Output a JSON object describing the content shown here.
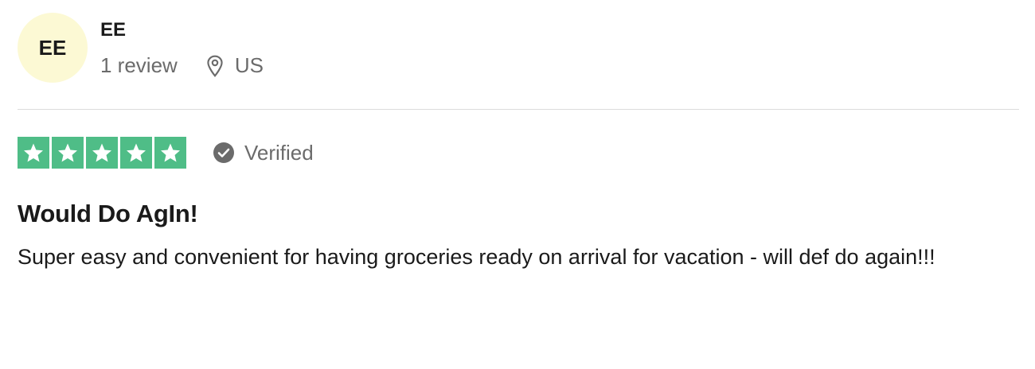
{
  "reviewer": {
    "initials": "EE",
    "name": "EE",
    "review_count": "1 review",
    "country": "US",
    "avatar_color": "#fcf9d4",
    "location_icon": "map-pin-icon"
  },
  "rating": {
    "stars": 5,
    "max_stars": 5,
    "star_color": "#4fbd87",
    "verified_label": "Verified",
    "verified_icon": "check-circle-icon"
  },
  "review": {
    "title": "Would Do AgIn!",
    "body": "Super easy and convenient for having groceries ready on arrival for vacation - will def do again!!!"
  }
}
